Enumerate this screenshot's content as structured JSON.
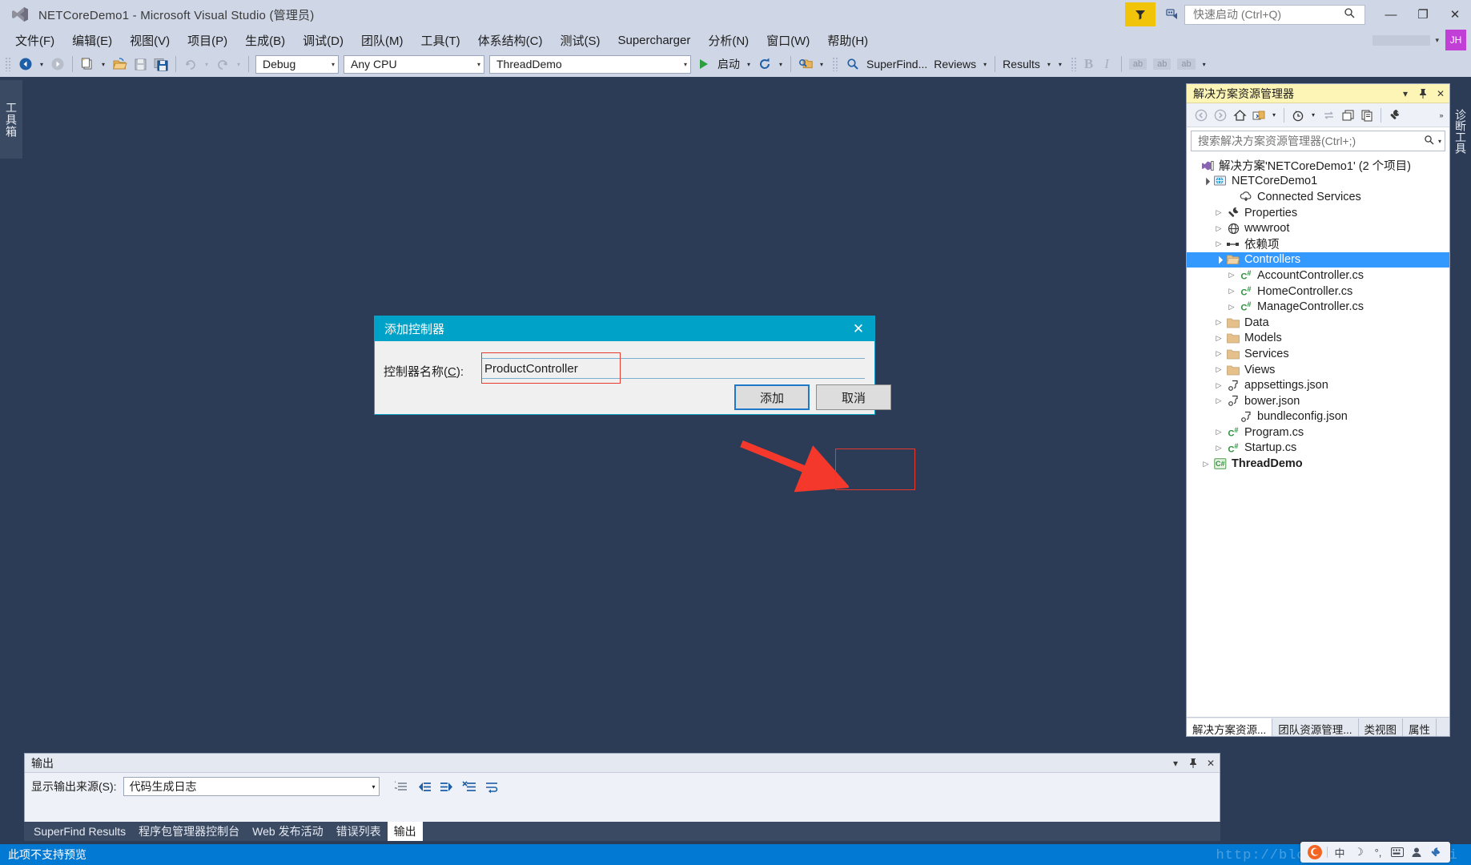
{
  "window": {
    "title": "NETCoreDemo1 - Microsoft Visual Studio (管理员)",
    "logo_icon": "visual-studio-logo",
    "minimize_glyph": "—",
    "maximize_glyph": "❐",
    "close_glyph": "✕"
  },
  "quick_launch": {
    "placeholder": "快速启动 (Ctrl+Q)",
    "value": "",
    "search_icon": "search-icon",
    "filter_icon": "funnel-icon",
    "feedback_icon": "feedback-icon"
  },
  "account": {
    "initials": "JH",
    "caret": "▾"
  },
  "menu": {
    "items": [
      {
        "label": "文件(F)"
      },
      {
        "label": "编辑(E)"
      },
      {
        "label": "视图(V)"
      },
      {
        "label": "项目(P)"
      },
      {
        "label": "生成(B)"
      },
      {
        "label": "调试(D)"
      },
      {
        "label": "团队(M)"
      },
      {
        "label": "工具(T)"
      },
      {
        "label": "体系结构(C)"
      },
      {
        "label": "测试(S)"
      },
      {
        "label": "Supercharger"
      },
      {
        "label": "分析(N)"
      },
      {
        "label": "窗口(W)"
      },
      {
        "label": "帮助(H)"
      }
    ]
  },
  "toolbar": {
    "nav_back_icon": "navigate-back-icon",
    "nav_forward_icon": "navigate-forward-icon",
    "new_item_icon": "new-item-icon",
    "open_file_icon": "open-folder-icon",
    "save_icon": "save-icon",
    "save_all_icon": "save-all-icon",
    "undo_icon": "undo-icon",
    "redo_icon": "redo-icon",
    "config_value": "Debug",
    "platform_value": "Any CPU",
    "startup_project_value": "ThreadDemo",
    "start_label": "启动",
    "start_icon": "play-icon",
    "refresh_icon": "refresh-icon",
    "find_icon": "find-in-files-icon",
    "superfind_label": "SuperFind...",
    "superfind_icon": "magnifier-icon",
    "reviews_label": "Reviews",
    "results_label": "Results",
    "bold_label": "B",
    "italic_label": "I",
    "ab_chips": [
      "ab",
      "ab",
      "ab"
    ],
    "caret": "▾"
  },
  "toolbox": {
    "label": "工具箱"
  },
  "diagnostic": {
    "label": "诊断工具"
  },
  "solution_explorer": {
    "title": "解决方案资源管理器",
    "dropdown_glyph": "▾",
    "pin_glyph": "⚲",
    "close_glyph": "✕",
    "toolbar_icons": [
      "back-icon",
      "forward-icon",
      "home-icon",
      "show-all-files-icon",
      "dropdown-icon",
      "pending-changes-icon",
      "sync-icon",
      "collapse-all-icon",
      "refresh-view-icon",
      "properties-icon"
    ],
    "search": {
      "placeholder": "搜索解决方案资源管理器(Ctrl+;)",
      "value": "",
      "search_icon": "search-icon",
      "caret": "▾"
    },
    "tree": [
      {
        "label": "解决方案'NETCoreDemo1' (2 个项目)",
        "icon": "solution-icon",
        "indent": 0,
        "arrow": "none",
        "selected": false,
        "bold": false
      },
      {
        "label": "NETCoreDemo1",
        "icon": "web-project-icon",
        "indent": 1,
        "arrow": "open",
        "selected": false,
        "bold": false
      },
      {
        "label": "Connected Services",
        "icon": "connected-services-icon",
        "indent": 3,
        "arrow": "none",
        "selected": false,
        "bold": false
      },
      {
        "label": "Properties",
        "icon": "wrench-icon",
        "indent": 2,
        "arrow": "closed",
        "selected": false,
        "bold": false
      },
      {
        "label": "wwwroot",
        "icon": "globe-icon",
        "indent": 2,
        "arrow": "closed",
        "selected": false,
        "bold": false
      },
      {
        "label": "依赖项",
        "icon": "dependencies-icon",
        "indent": 2,
        "arrow": "closed",
        "selected": false,
        "bold": false
      },
      {
        "label": "Controllers",
        "icon": "folder-open-icon",
        "indent": 2,
        "arrow": "open",
        "selected": true,
        "bold": false
      },
      {
        "label": "AccountController.cs",
        "icon": "csharp-file-icon",
        "indent": 3,
        "arrow": "closed",
        "selected": false,
        "bold": false
      },
      {
        "label": "HomeController.cs",
        "icon": "csharp-file-icon",
        "indent": 3,
        "arrow": "closed",
        "selected": false,
        "bold": false
      },
      {
        "label": "ManageController.cs",
        "icon": "csharp-file-icon",
        "indent": 3,
        "arrow": "closed",
        "selected": false,
        "bold": false
      },
      {
        "label": "Data",
        "icon": "folder-icon",
        "indent": 2,
        "arrow": "closed",
        "selected": false,
        "bold": false
      },
      {
        "label": "Models",
        "icon": "folder-icon",
        "indent": 2,
        "arrow": "closed",
        "selected": false,
        "bold": false
      },
      {
        "label": "Services",
        "icon": "folder-icon",
        "indent": 2,
        "arrow": "closed",
        "selected": false,
        "bold": false
      },
      {
        "label": "Views",
        "icon": "folder-icon",
        "indent": 2,
        "arrow": "closed",
        "selected": false,
        "bold": false
      },
      {
        "label": "appsettings.json",
        "icon": "json-file-icon",
        "indent": 2,
        "arrow": "closed",
        "selected": false,
        "bold": false
      },
      {
        "label": "bower.json",
        "icon": "json-file-icon",
        "indent": 2,
        "arrow": "closed",
        "selected": false,
        "bold": false
      },
      {
        "label": "bundleconfig.json",
        "icon": "json-file-icon",
        "indent": 3,
        "arrow": "none",
        "selected": false,
        "bold": false
      },
      {
        "label": "Program.cs",
        "icon": "csharp-file-icon",
        "indent": 2,
        "arrow": "closed",
        "selected": false,
        "bold": false
      },
      {
        "label": "Startup.cs",
        "icon": "csharp-file-icon",
        "indent": 2,
        "arrow": "closed",
        "selected": false,
        "bold": false
      },
      {
        "label": "ThreadDemo",
        "icon": "csharp-project-icon",
        "indent": 1,
        "arrow": "closed",
        "selected": false,
        "bold": true
      }
    ],
    "tabs": [
      {
        "label": "解决方案资源...",
        "active": true
      },
      {
        "label": "团队资源管理...",
        "active": false
      },
      {
        "label": "类视图",
        "active": false
      },
      {
        "label": "属性",
        "active": false
      }
    ]
  },
  "output_panel": {
    "title": "输出",
    "dropdown_glyph": "▾",
    "pin_glyph": "⚲",
    "close_glyph": "✕",
    "source_label": "显示输出来源(S):",
    "source_value": "代码生成日志",
    "source_caret": "▾",
    "icons": [
      "clear-pane-icon",
      "go-to-previous-icon",
      "go-to-next-icon",
      "clear-all-icon",
      "toggle-word-wrap-icon"
    ],
    "scroll_left_glyph": "◀",
    "scroll_right_glyph": "▶",
    "content": ""
  },
  "bottom_tabs": [
    {
      "label": "SuperFind Results",
      "active": false
    },
    {
      "label": "程序包管理器控制台",
      "active": false
    },
    {
      "label": "Web 发布活动",
      "active": false
    },
    {
      "label": "错误列表",
      "active": false
    },
    {
      "label": "输出",
      "active": true
    }
  ],
  "status_bar": {
    "text": "此项不支持预览",
    "watermark": "http://blog.csdn.net/gangji",
    "color": "#0279d3"
  },
  "ime": {
    "logo_icon": "sogou-ime-icon",
    "buttons": [
      "中",
      "☽",
      "°,",
      "⌨",
      "👤",
      "🔧"
    ]
  },
  "dialog": {
    "title": "添加控制器",
    "close_glyph": "✕",
    "field_label_prefix": "控制器名称(",
    "field_label_accel": "C",
    "field_label_suffix": "):",
    "field_value": "ProductController",
    "field_placeholder": "",
    "add_button": "添加",
    "cancel_button": "取消",
    "title_bg": "#00a2c7",
    "annotation_color": "#e8392f"
  },
  "theme": {
    "chrome_bg": "#cfd6e6",
    "editor_bg": "#2d3c56",
    "accent": "#0279d3",
    "selection": "#3399ff",
    "se_header": "#fdf5b5"
  }
}
